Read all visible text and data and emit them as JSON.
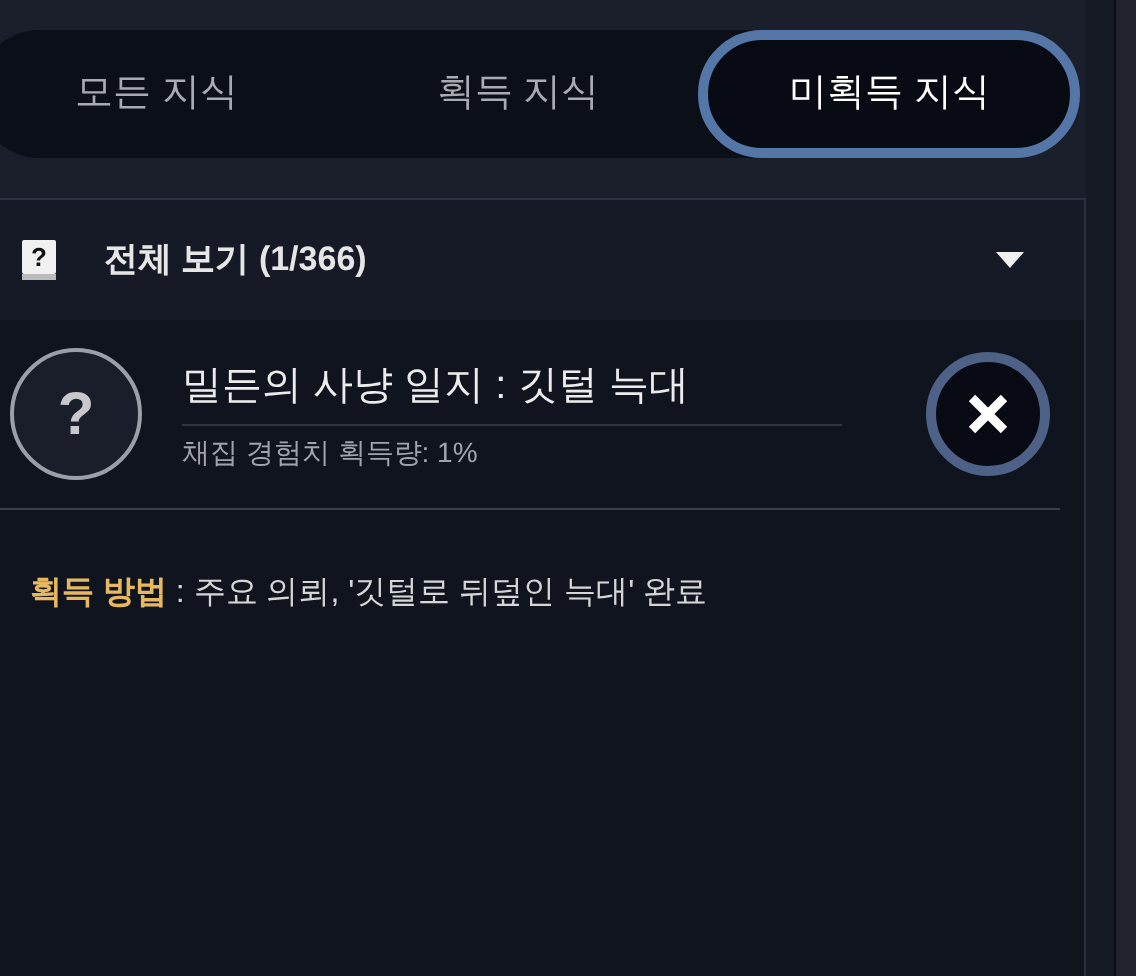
{
  "tabs": [
    {
      "label": "모든 지식",
      "selected": false
    },
    {
      "label": "획득 지식",
      "selected": false
    },
    {
      "label": "미획득 지식",
      "selected": true
    }
  ],
  "filter": {
    "label": "전체 보기 (1/366)",
    "expanded": false
  },
  "entry": {
    "icon": "?",
    "title": "밀든의 사냥 일지 : 깃털 늑대",
    "subtitle": "채집 경험치 획득량: 1%",
    "acquired": false
  },
  "method": "**획득 방법** : 주요 의뢰, '깃털로 뒤덮인 늑대' 완료"
}
